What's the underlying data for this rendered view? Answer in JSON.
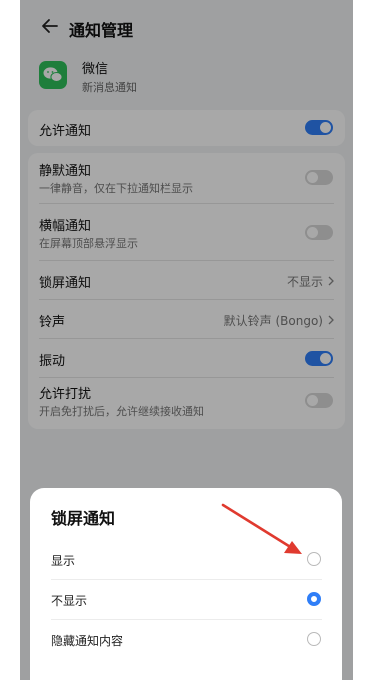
{
  "header": {
    "title": "通知管理"
  },
  "app": {
    "name": "微信",
    "subtitle": "新消息通知"
  },
  "settings": {
    "allow": {
      "label": "允许通知",
      "on": true
    },
    "silent": {
      "label": "静默通知",
      "sub": "一律静音，仅在下拉通知栏显示",
      "on": false
    },
    "banner": {
      "label": "横幅通知",
      "sub": "在屏幕顶部悬浮显示",
      "on": false
    },
    "lockscreen": {
      "label": "锁屏通知",
      "value": "不显示"
    },
    "ringtone": {
      "label": "铃声",
      "value": "默认铃声 (Bongo)"
    },
    "vibrate": {
      "label": "振动",
      "on": true
    },
    "dnd": {
      "label": "允许打扰",
      "sub": "开启免打扰后，允许继续接收通知",
      "on": false
    }
  },
  "dialog": {
    "title": "锁屏通知",
    "options": [
      {
        "label": "显示",
        "selected": false
      },
      {
        "label": "不显示",
        "selected": true
      },
      {
        "label": "隐藏通知内容",
        "selected": false
      }
    ]
  },
  "colors": {
    "accent": "#2f7ef7",
    "wechat": "#2ec05a",
    "annotation": "#e03a2f"
  }
}
